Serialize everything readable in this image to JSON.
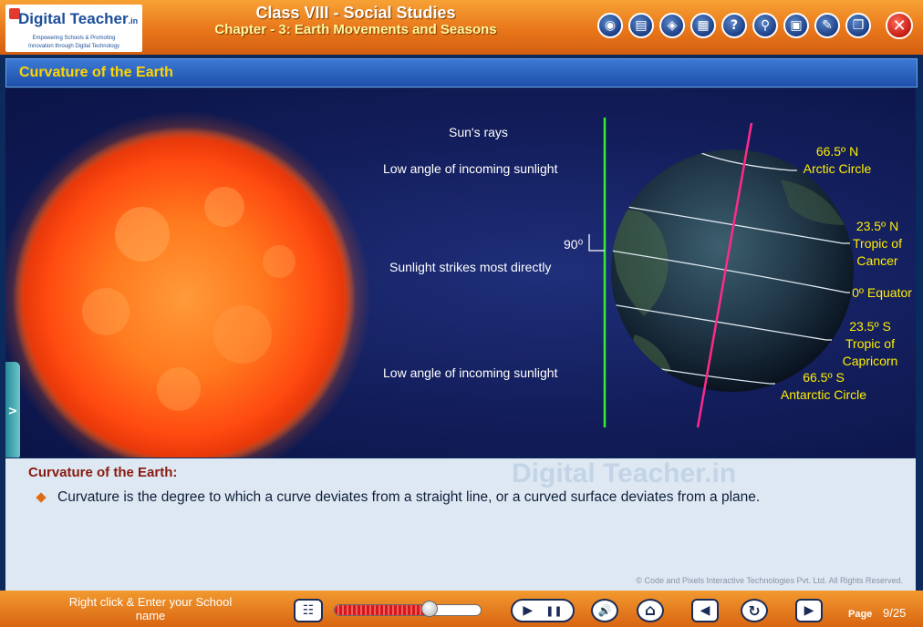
{
  "header": {
    "logo_text": "Digital Teacher",
    "logo_suffix": ".in",
    "logo_tagline_1": "Empowering Schools & Promoting",
    "logo_tagline_2": "Innovation through Digital Technology",
    "title": "Class VIII - Social Studies",
    "chapter": "Chapter - 3: Earth Movements and Seasons",
    "toolbar_icons": [
      "camera-icon",
      "book-icon",
      "eye-icon",
      "notes-icon",
      "help-icon",
      "search-icon",
      "pdf-icon",
      "tools-icon",
      "window-icon"
    ],
    "close_label": "✕"
  },
  "section": {
    "title": "Curvature of the Earth"
  },
  "diagram": {
    "suns_rays": "Sun's rays",
    "low_angle_top": "Low angle of incoming sunlight",
    "direct": "Sunlight strikes most directly",
    "low_angle_bottom": "Low angle of incoming sunlight",
    "angle": "90⁰",
    "arctic_deg": "66.5º N",
    "arctic_name": "Arctic Circle",
    "cancer_deg": "23.5º N",
    "cancer_name_1": "Tropic of",
    "cancer_name_2": "Cancer",
    "equator": "0º Equator",
    "capricorn_deg": "23.5º S",
    "capricorn_name_1": "Tropic of",
    "capricorn_name_2": "Capricorn",
    "antarctic_deg": "66.5º S",
    "antarctic_name": "Antarctic Circle",
    "side_tab": ">"
  },
  "panel": {
    "watermark": "Digital Teacher.in",
    "heading": "Curvature of the Earth:",
    "text": "Curvature is the degree to which a curve deviates from a straight line, or a curved surface deviates from a plane.",
    "copyright": "© Code and Pixels Interactive Technologies Pvt. Ltd. All Rights Reserved."
  },
  "footer": {
    "school_name": "Right click & Enter your School name",
    "progress_percent": 65,
    "page_label": "Page",
    "page_number": "9/25",
    "controls": {
      "menu": "☷",
      "play": "▶",
      "pause": "❚❚",
      "volume": "🔊",
      "home": "⌂",
      "prev": "◀",
      "replay": "↻",
      "next": "▶"
    }
  }
}
